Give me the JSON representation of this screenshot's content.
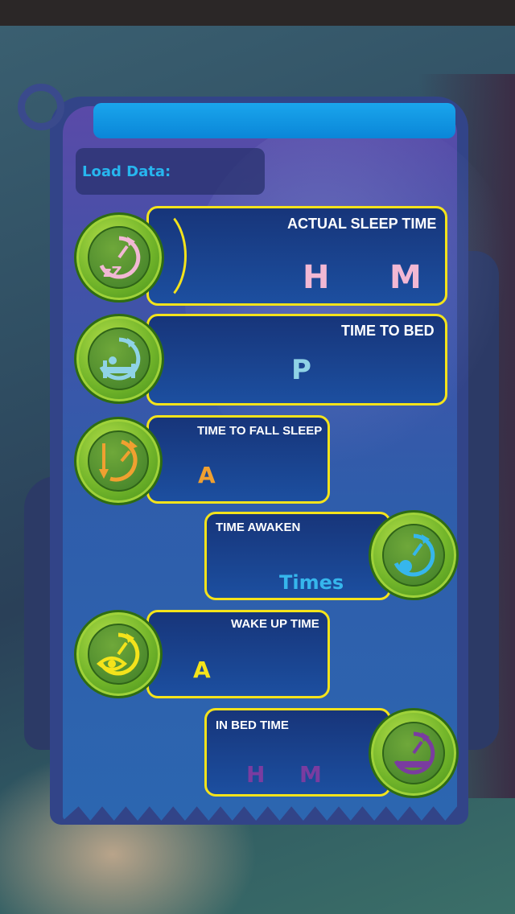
{
  "load": {
    "label": "Load Data:"
  },
  "panels": {
    "actual_sleep": {
      "title": "ACTUAL SLEEP TIME",
      "hours_unit": "H",
      "minutes_unit": "M"
    },
    "time_to_bed": {
      "title": "TIME TO BED",
      "value": "P"
    },
    "fall_asleep": {
      "title": "TIME TO FALL SLEEP",
      "value": "A"
    },
    "awaken": {
      "title": "TIME AWAKEN",
      "value": "Times"
    },
    "wake_up": {
      "title": "WAKE UP TIME",
      "value": "A"
    },
    "in_bed": {
      "title": "IN BED TIME",
      "hours_unit": "H",
      "minutes_unit": "M"
    }
  },
  "colors": {
    "accent_border": "#f4e31b",
    "title_bar": "#0a86d8",
    "load_label": "#27b6ef",
    "actual_sleep_value": "#f2b8d4",
    "time_to_bed_value": "#8fd3e6",
    "fall_asleep_value": "#f0a030",
    "awaken_value": "#36b6ec",
    "wake_up_value": "#f4e31b",
    "in_bed_value": "#7a3ca0"
  },
  "icons": {
    "actual_sleep": "sleep-clock-zz-icon",
    "time_to_bed": "bed-clock-icon",
    "fall_asleep": "fall-asleep-arrows-clock-icon",
    "awaken": "awaken-clock-icon",
    "wake_up": "eye-clock-icon",
    "in_bed": "in-bed-clock-icon"
  }
}
